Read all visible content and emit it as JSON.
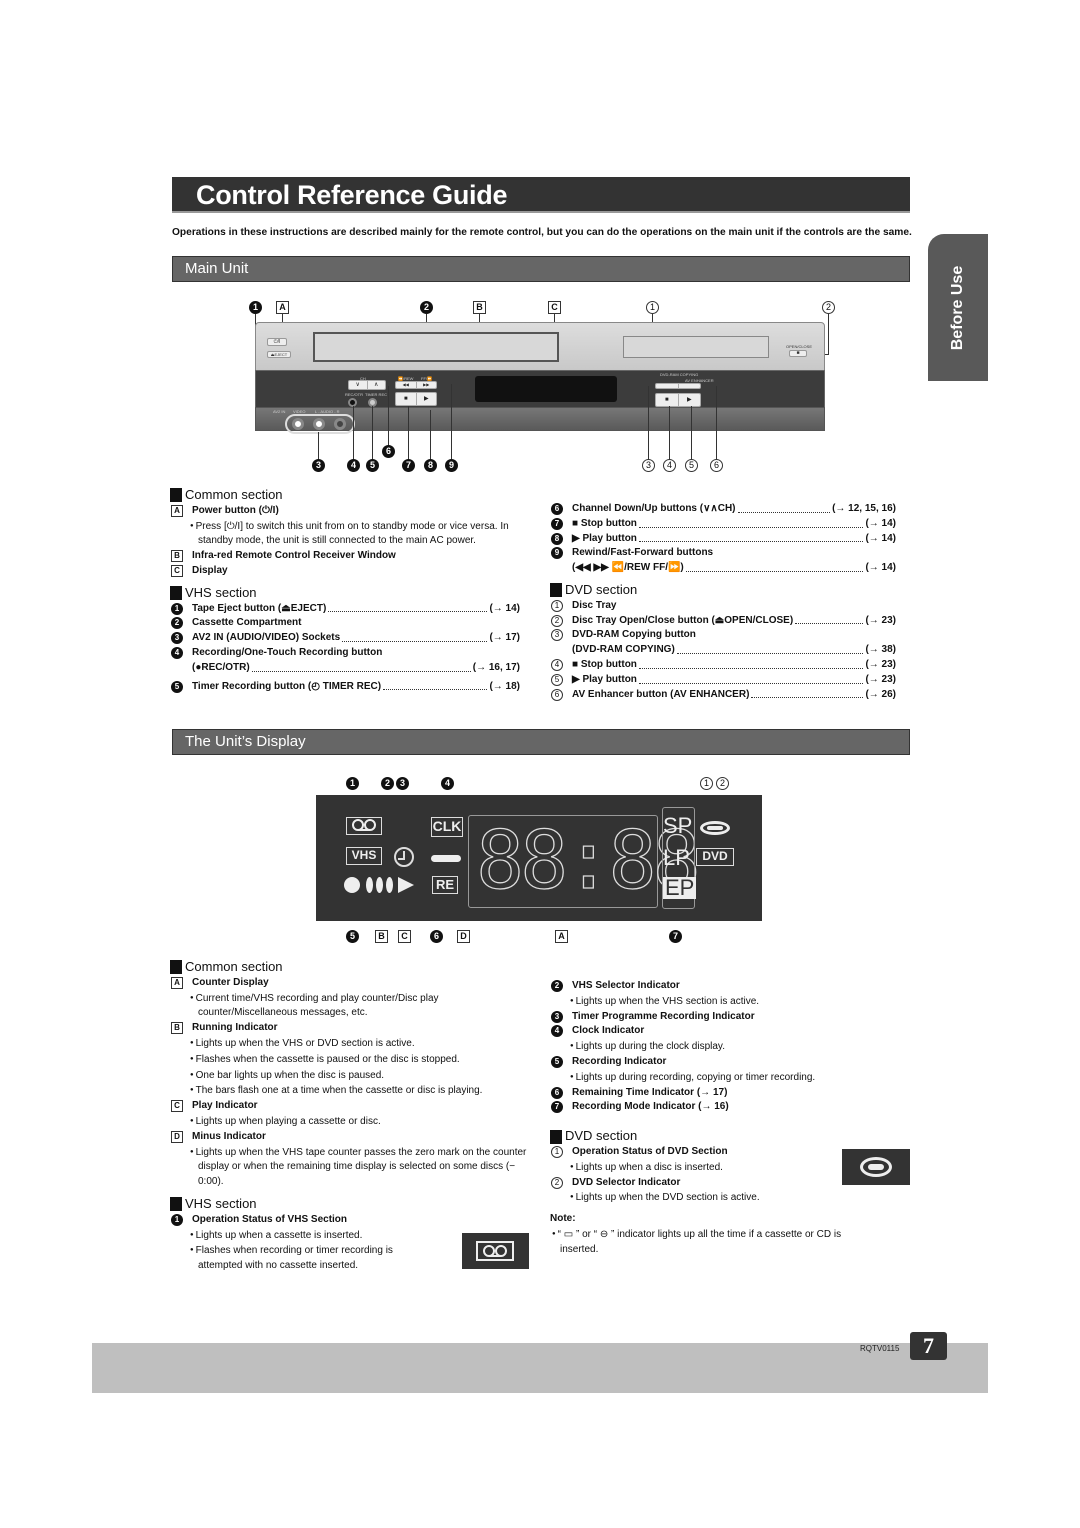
{
  "page": {
    "title": "Control Reference Guide",
    "intro": "Operations in these instructions are described mainly for the remote control, but you can do the operations on the main unit if the controls are the same.",
    "side_tab": "Before Use",
    "doc_code": "RQTV0115",
    "page_number": "7"
  },
  "main_unit": {
    "heading": "Main Unit",
    "diagram": {
      "labels": {
        "power": "⏻/I",
        "eject": "⏏EJECT",
        "ch": "CH",
        "rew": "⏪/REW",
        "ff": "FF/⏩",
        "rec_otr": "REC/OTR",
        "timer_rec": "TIMER REC",
        "av2_in": "AV2 IN",
        "video": "VIDEO",
        "audio": "L - AUDIO - R",
        "dvd_ram_copying": "DVD-RAM COPYING",
        "av_enhancer": "AV ENHANCER",
        "open_close": "OPEN/CLOSE",
        "stop": "■",
        "play": "▶"
      },
      "callouts_top": [
        "1",
        "A",
        "2",
        "B",
        "C",
        "1",
        "2"
      ],
      "callouts_bottom_vhs": [
        "3",
        "4",
        "5",
        "6",
        "7",
        "8",
        "9"
      ],
      "callouts_bottom_dvd": [
        "3",
        "4",
        "5",
        "6"
      ]
    },
    "common": {
      "heading": "Common section",
      "items": [
        {
          "marker": "A",
          "name": "Power button (⏻/I)",
          "ref": "",
          "bullets": [
            "Press [⏻/I] to switch this unit from on to standby mode or vice versa. In standby mode, the unit is still connected to the main AC power."
          ]
        },
        {
          "marker": "B",
          "name": "Infra-red Remote Control Receiver Window",
          "ref": "",
          "bullets": []
        },
        {
          "marker": "C",
          "name": "Display",
          "ref": "",
          "bullets": []
        }
      ]
    },
    "vhs": {
      "heading": "VHS section",
      "items": [
        {
          "marker": "1",
          "name": "Tape Eject button (⏏EJECT)",
          "ref": "(→ 14)"
        },
        {
          "marker": "2",
          "name": "Cassette Compartment",
          "ref": ""
        },
        {
          "marker": "3",
          "name": "AV2 IN (AUDIO/VIDEO) Sockets",
          "ref": "(→ 17)"
        },
        {
          "marker": "4",
          "name": "Recording/One-Touch Recording button",
          "name2": "(●REC/OTR)",
          "ref": "(→ 16, 17)"
        },
        {
          "marker": "5",
          "name": "Timer Recording button (◴ TIMER REC)",
          "ref": "(→ 18)"
        },
        {
          "marker": "6",
          "name": "Channel Down/Up buttons (∨∧CH)",
          "ref": "(→ 12, 15, 16)"
        },
        {
          "marker": "7",
          "name": "■ Stop button",
          "ref": "(→ 14)"
        },
        {
          "marker": "8",
          "name": "▶ Play button",
          "ref": "(→ 14)"
        },
        {
          "marker": "9",
          "name": "Rewind/Fast-Forward buttons",
          "name2": "(◀◀ ▶▶ ⏪/REW FF/⏩)",
          "ref": "(→ 14)"
        }
      ]
    },
    "dvd": {
      "heading": "DVD section",
      "items": [
        {
          "marker": "1",
          "name": "Disc Tray",
          "ref": ""
        },
        {
          "marker": "2",
          "name": "Disc Tray Open/Close button (⏏OPEN/CLOSE)",
          "ref": "(→ 23)"
        },
        {
          "marker": "3",
          "name": "DVD-RAM Copying button",
          "name2": "(DVD-RAM COPYING)",
          "ref": "(→ 38)"
        },
        {
          "marker": "4",
          "name": "■ Stop button",
          "ref": "(→ 23)"
        },
        {
          "marker": "5",
          "name": "▶ Play button",
          "ref": "(→ 23)"
        },
        {
          "marker": "6",
          "name": "AV Enhancer button (AV ENHANCER)",
          "ref": "(→ 26)"
        }
      ]
    }
  },
  "unit_display": {
    "heading": "The Unit’s Display",
    "diagram": {
      "vhs_label": "VHS",
      "clk_label": "CLK",
      "re_label": "RE",
      "digits": "88:88",
      "modes": [
        "SP",
        "LP",
        "EP"
      ],
      "dvd_label": "DVD",
      "callouts_top": [
        "1",
        "2",
        "3",
        "4",
        "1",
        "2"
      ],
      "callouts_bottom": [
        "5",
        "B",
        "C",
        "6",
        "D",
        "A",
        "7"
      ]
    },
    "common": {
      "heading": "Common section",
      "items": [
        {
          "marker": "A",
          "name": "Counter Display",
          "bullets": [
            "Current time/VHS recording and play counter/Disc play counter/Miscellaneous messages, etc."
          ]
        },
        {
          "marker": "B",
          "name": "Running Indicator",
          "bullets": [
            "Lights up when the VHS or DVD section is active.",
            "Flashes when the cassette is paused or the disc is stopped.",
            "One bar lights up when the disc is paused.",
            "The bars flash one at a time when the cassette or disc is playing."
          ]
        },
        {
          "marker": "C",
          "name": "Play Indicator",
          "bullets": [
            "Lights up when playing a cassette or disc."
          ]
        },
        {
          "marker": "D",
          "name": "Minus Indicator",
          "bullets": [
            "Lights up when the VHS tape counter passes the zero mark on the counter display or when the remaining time display is selected on some discs (− 0:00)."
          ]
        }
      ]
    },
    "vhs": {
      "heading": "VHS section",
      "items": [
        {
          "marker": "1",
          "name": "Operation Status of VHS Section",
          "bullets": [
            "Lights up when a cassette is inserted.",
            "Flashes when recording or timer recording is attempted with no cassette inserted."
          ]
        },
        {
          "marker": "2",
          "name": "VHS Selector Indicator",
          "bullets": [
            "Lights up when the VHS section is active."
          ]
        },
        {
          "marker": "3",
          "name": "Timer Programme Recording Indicator",
          "bullets": []
        },
        {
          "marker": "4",
          "name": "Clock Indicator",
          "bullets": [
            "Lights up during the clock display."
          ]
        },
        {
          "marker": "5",
          "name": "Recording Indicator",
          "bullets": [
            "Lights up during recording, copying or timer recording."
          ]
        },
        {
          "marker": "6",
          "name": "Remaining Time Indicator (→ 17)",
          "bullets": []
        },
        {
          "marker": "7",
          "name": "Recording Mode Indicator (→ 16)",
          "bullets": []
        }
      ]
    },
    "dvd": {
      "heading": "DVD section",
      "items": [
        {
          "marker": "1",
          "name": "Operation Status of DVD Section",
          "bullets": [
            "Lights up when a disc is inserted."
          ]
        },
        {
          "marker": "2",
          "name": "DVD Selector Indicator",
          "bullets": [
            "Lights up when the DVD section is active."
          ]
        }
      ]
    },
    "note": {
      "label": "Note:",
      "text": "“ ▭ ” or “ ⊖ ” indicator lights up all the time if a cassette or CD is inserted."
    }
  }
}
